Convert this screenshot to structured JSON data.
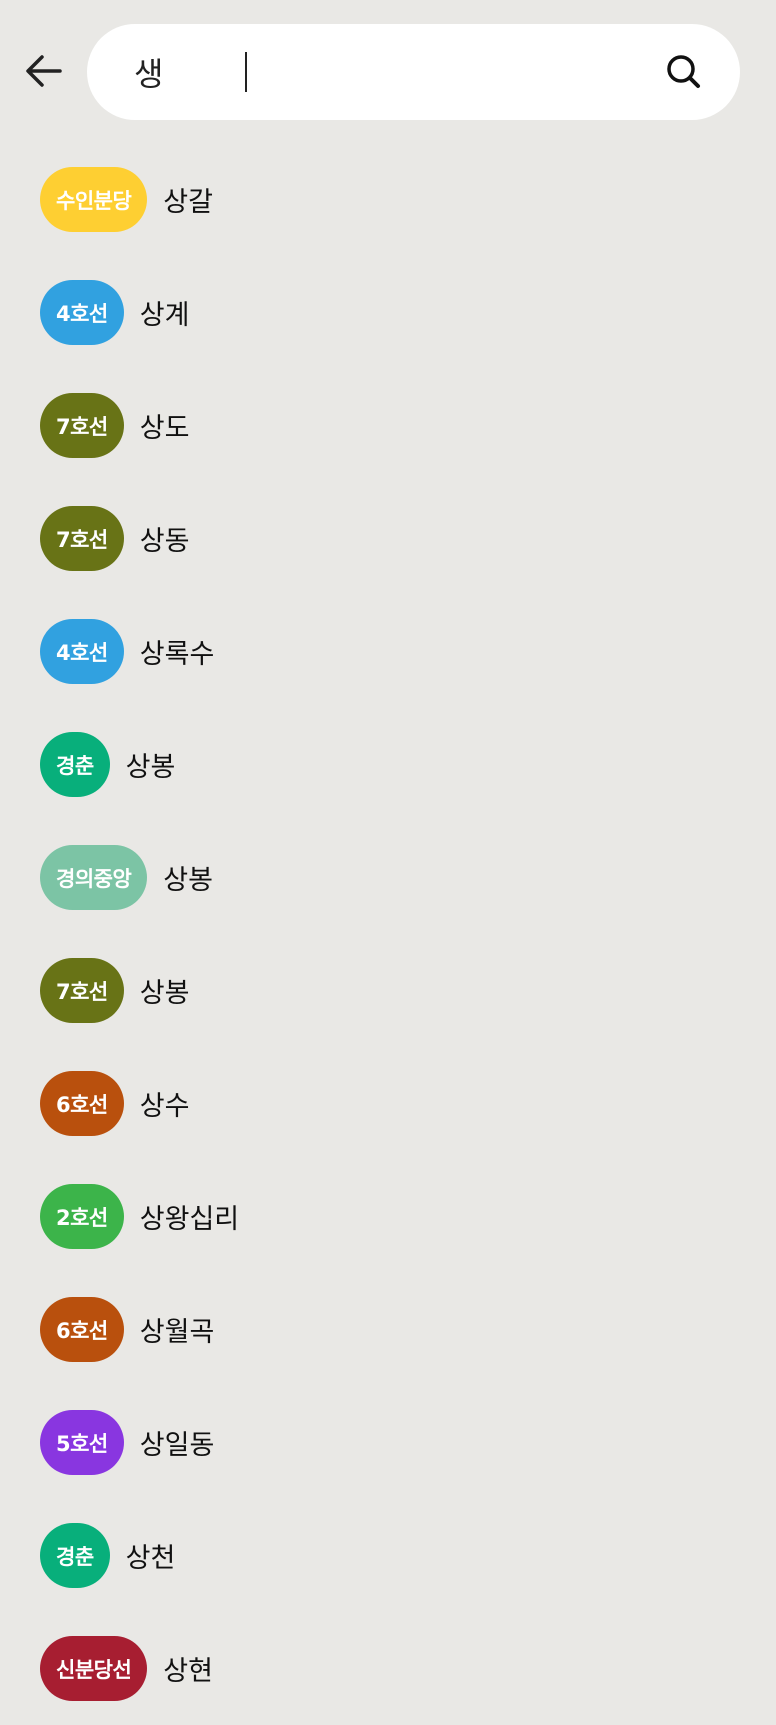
{
  "search": {
    "query": "생",
    "back_icon": "arrow-left-icon",
    "search_icon": "search-icon"
  },
  "results": [
    {
      "line": "수인분당",
      "station": "상갈",
      "color": "#fecf32"
    },
    {
      "line": "4호선",
      "station": "상계",
      "color": "#31a1e0"
    },
    {
      "line": "7호선",
      "station": "상도",
      "color": "#687316"
    },
    {
      "line": "7호선",
      "station": "상동",
      "color": "#687316"
    },
    {
      "line": "4호선",
      "station": "상록수",
      "color": "#31a1e0"
    },
    {
      "line": "경춘",
      "station": "상봉",
      "color": "#08af7b"
    },
    {
      "line": "경의중앙",
      "station": "상봉",
      "color": "#7cc4a5"
    },
    {
      "line": "7호선",
      "station": "상봉",
      "color": "#687316"
    },
    {
      "line": "6호선",
      "station": "상수",
      "color": "#b9500d"
    },
    {
      "line": "2호선",
      "station": "상왕십리",
      "color": "#3cb44a"
    },
    {
      "line": "6호선",
      "station": "상월곡",
      "color": "#b9500d"
    },
    {
      "line": "5호선",
      "station": "상일동",
      "color": "#8936e0"
    },
    {
      "line": "경춘",
      "station": "상천",
      "color": "#08af7b"
    },
    {
      "line": "신분당선",
      "station": "상현",
      "color": "#a71e31"
    }
  ]
}
